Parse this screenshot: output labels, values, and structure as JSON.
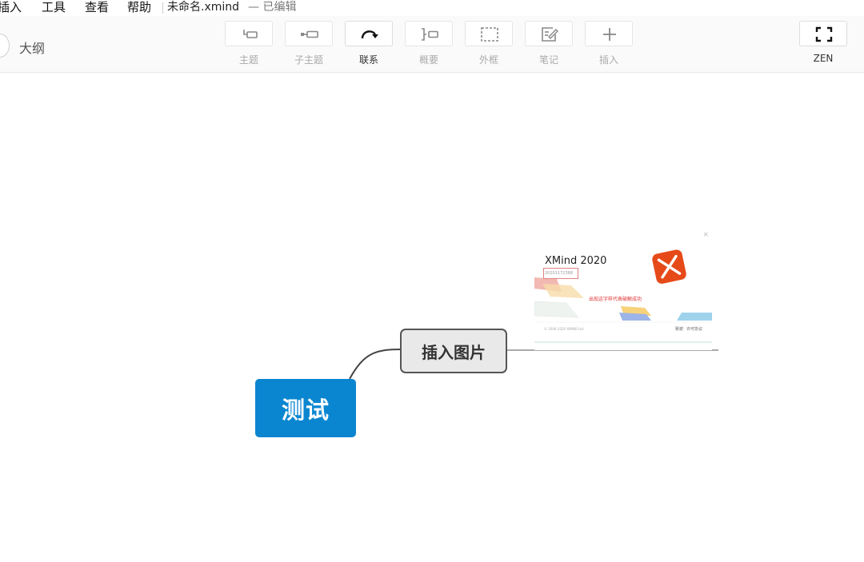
{
  "menubar": {
    "items": [
      "插入",
      "工具",
      "查看",
      "帮助"
    ],
    "file_title": "未命名.xmind",
    "status": "— 已编辑"
  },
  "toolbar": {
    "outline_label": "大纲",
    "tools": [
      {
        "label": "主题",
        "icon": "topic-icon"
      },
      {
        "label": "子主题",
        "icon": "subtopic-icon"
      },
      {
        "label": "联系",
        "icon": "relationship-icon"
      },
      {
        "label": "概要",
        "icon": "summary-icon"
      },
      {
        "label": "外框",
        "icon": "boundary-icon"
      },
      {
        "label": "笔记",
        "icon": "note-icon"
      },
      {
        "label": "插入",
        "icon": "plus-icon"
      }
    ],
    "zen_label": "ZEN"
  },
  "mindmap": {
    "root_topic": "测试",
    "sub_topic": "插入图片",
    "root_color": "#0a86d1",
    "image": {
      "title": "XMind 2020",
      "code": "20201172368",
      "red_text": "出现这字样代表破解成功",
      "footer_left": "© 2006-2020 XMIND Ltd.",
      "footer_right_1": "致谢",
      "footer_right_2": "许可协议",
      "close": "×"
    }
  }
}
